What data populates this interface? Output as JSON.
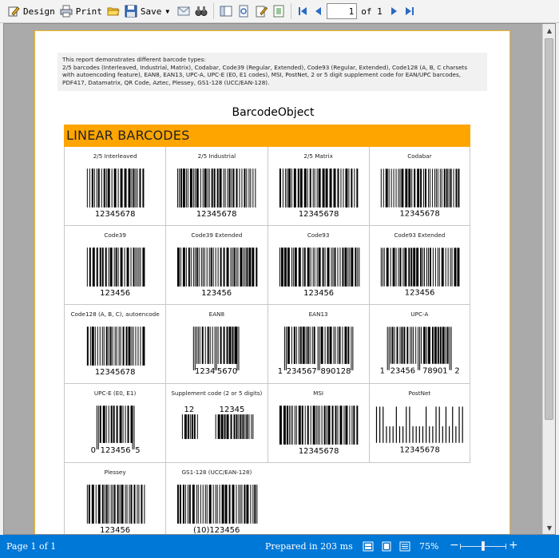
{
  "toolbar": {
    "design_label": "Design",
    "print_label": "Print",
    "save_label": "Save",
    "page_value": "1",
    "of_label": "of 1"
  },
  "report": {
    "description_lines": [
      "This report demonstrates different barcode types:",
      "2/5 barcodes (Interleaved, Industrial, Matrix), Codabar, Code39 (Regular, Extended), Code93 (Regular, Extended), Code128 (A, B, C charsets",
      "with autoencoding feature), EAN8, EAN13, UPC-A, UPC-E (E0, E1 codes), MSI, PostNet, 2 or 5 digit supplement code for EAN/UPC barcodes,",
      "PDF417, Datamatrix, QR Code, Aztec, Plessey, GS1-128 (UCC/EAN-128)."
    ],
    "title": "BarcodeObject",
    "section_header": "LINEAR BARCODES"
  },
  "barcodes": [
    {
      "title": "2/5 Interleaved",
      "kind": "std",
      "text": "12345678"
    },
    {
      "title": "2/5 Industrial",
      "kind": "std",
      "text": "12345678"
    },
    {
      "title": "2/5 Matrix",
      "kind": "std",
      "text": "12345678"
    },
    {
      "title": "Codabar",
      "kind": "std",
      "text": "12345678"
    },
    {
      "title": "Code39",
      "kind": "std",
      "text": "123456"
    },
    {
      "title": "Code39 Extended",
      "kind": "std",
      "text": "123456"
    },
    {
      "title": "Code93",
      "kind": "std",
      "text": "123456"
    },
    {
      "title": "Code93 Extended",
      "kind": "std",
      "text": "123456"
    },
    {
      "title": "Code128 (A, B, C), autoencode",
      "kind": "std",
      "text": "12345678"
    },
    {
      "title": "EAN8",
      "kind": "ean8",
      "left": "1234",
      "right": "5670"
    },
    {
      "title": "EAN13",
      "kind": "ean13",
      "first": "1",
      "left": "234567",
      "right": "890128"
    },
    {
      "title": "UPC-A",
      "kind": "upca",
      "first": "1",
      "left": "23456",
      "right": "78901",
      "last": "2"
    },
    {
      "title": "UPC-E (E0, E1)",
      "kind": "upce",
      "first": "0",
      "mid": "123456",
      "last": "5"
    },
    {
      "title": "Supplement code (2 or 5 digits)",
      "kind": "supp",
      "a": "12",
      "b": "12345"
    },
    {
      "title": "MSI",
      "kind": "std",
      "text": "12345678"
    },
    {
      "title": "PostNet",
      "kind": "postnet",
      "text": "12345678"
    },
    {
      "title": "Plessey",
      "kind": "std",
      "text": "123456"
    },
    {
      "title": "GS1-128 (UCC/EAN-128)",
      "kind": "std",
      "text": "(10)123456"
    }
  ],
  "status": {
    "page": "Page 1 of 1",
    "prepared": "Prepared in 203 ms",
    "zoom": "75%"
  }
}
